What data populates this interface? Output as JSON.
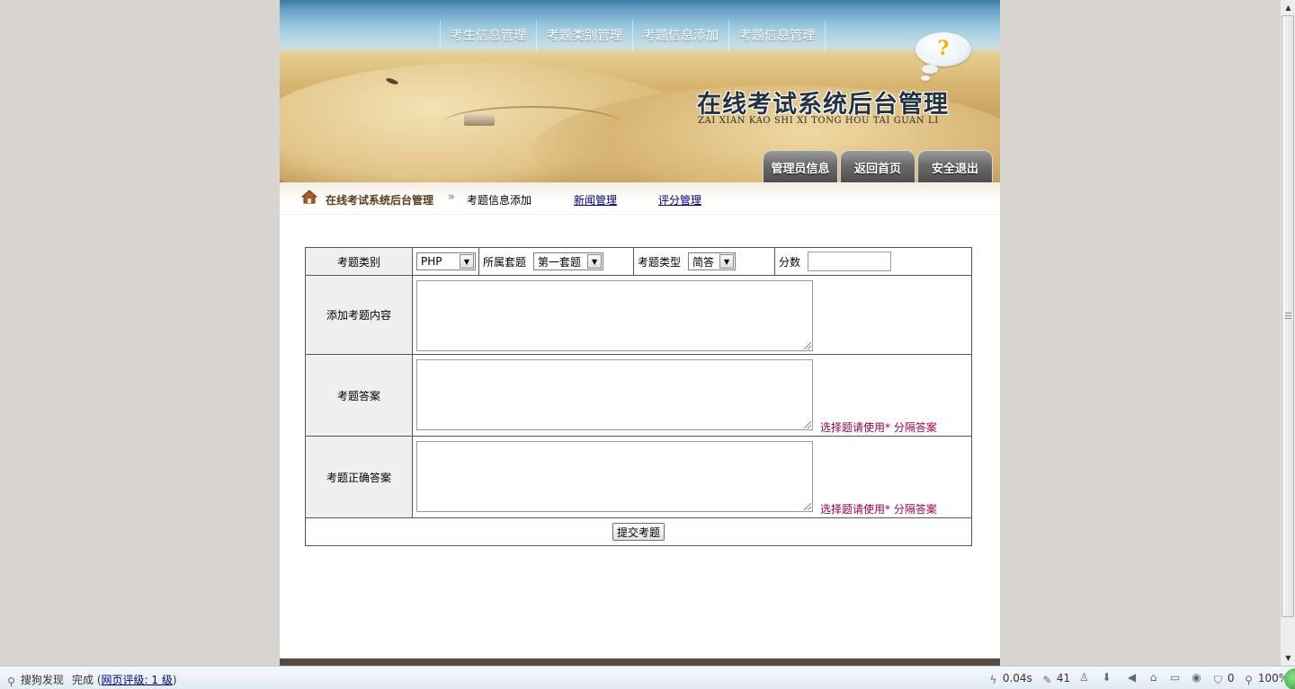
{
  "nav": {
    "items": [
      "考生信息管理",
      "考题类别管理",
      "考题信息添加",
      "考题信息管理"
    ]
  },
  "header": {
    "bubble_glyph": "?",
    "title": "在线考试系统后台管理",
    "subtitle": "ZAI XIAN KAO SHI XI TONG HOU TAI GUAN LI",
    "tabs": [
      "管理员信息",
      "返回首页",
      "安全退出"
    ]
  },
  "breadcrumb": {
    "root": "在线考试系统后台管理",
    "separator": "»",
    "current": "考题信息添加",
    "links": [
      "新闻管理",
      "评分管理"
    ]
  },
  "form": {
    "category_label": "考题类别",
    "category_value": "PHP",
    "set_label": "所属套题",
    "set_value": "第一套题",
    "type_label": "考题类型",
    "type_value": "简答",
    "score_label": "分数",
    "score_value": "",
    "content_label": "添加考题内容",
    "answer_label": "考题答案",
    "answer_hint": "选择题请使用* 分隔答案",
    "correct_label": "考题正确答案",
    "correct_hint": "选择题请使用* 分隔答案",
    "submit_label": "提交考题"
  },
  "statusbar": {
    "discover": "搜狗发现",
    "done": "完成",
    "rating_prefix": "(",
    "rating_link": "网页评级: 1 级",
    "rating_suffix": ")",
    "load_time": "0.04s",
    "count": "41",
    "shield_count": "0",
    "zoom": "100%"
  },
  "colors": {
    "hint": "#99004d",
    "link": "#00007a",
    "footer_strip": "#594a3f",
    "label_bg": "#efefef"
  }
}
